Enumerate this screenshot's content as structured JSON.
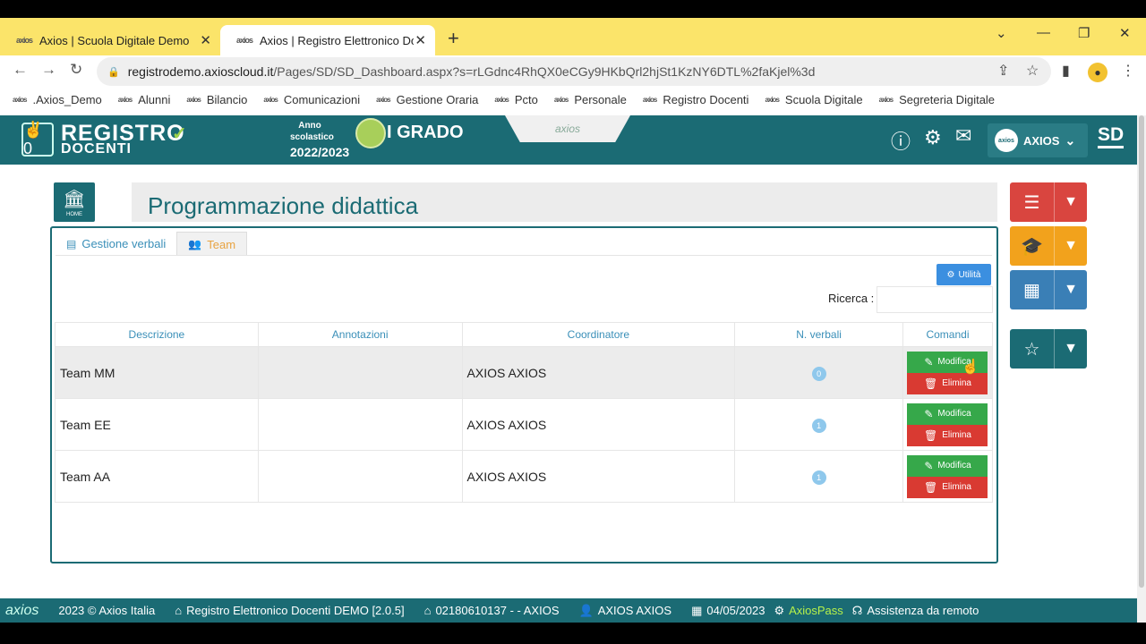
{
  "browser": {
    "tabs": [
      {
        "label": "Axios | Scuola Digitale Demo",
        "active": false
      },
      {
        "label": "Axios | Registro Elettronico Doce",
        "active": true
      }
    ],
    "favicon_text": "axios",
    "close_glyph": "✕",
    "new_tab_glyph": "+",
    "url_host": "registrodemo.axioscloud.it",
    "url_path": "/Pages/SD/SD_Dashboard.aspx?s=rLGdnc4RhQX0eCGy9HKbQrl2hjSt1KzNY6DTL%2faKjel%3d",
    "bookmarks": [
      ".Axios_Demo",
      "Alunni",
      "Bilancio",
      "Comunicazioni",
      "Gestione Oraria",
      "Pcto",
      "Personale",
      "Registro Docenti",
      "Scuola Digitale",
      "Segreteria Digitale"
    ]
  },
  "header": {
    "logo_line1": "REGISTRO",
    "logo_line2": "DOCENTI",
    "logo_badge": "✌0",
    "anno_label": "Anno scolastico",
    "anno_value": "2022/2023",
    "grado": "I GRADO",
    "center_logo": "axios",
    "user_avatar": "axios",
    "user_name": "AXIOS",
    "sd": "SD"
  },
  "page": {
    "home_label": "HOME",
    "title": "Programmazione didattica",
    "tabs": [
      {
        "label": "Gestione verbali",
        "active": false
      },
      {
        "label": "Team",
        "active": true
      }
    ],
    "utilita_label": "Utilità",
    "search_label": "Ricerca :",
    "search_value": ""
  },
  "table": {
    "columns": [
      "Descrizione",
      "Annotazioni",
      "Coordinatore",
      "N. verbali",
      "Comandi"
    ],
    "rows": [
      {
        "descrizione": "Team MM",
        "annotazioni": "",
        "coordinatore": "AXIOS AXIOS",
        "verbali": "0"
      },
      {
        "descrizione": "Team EE",
        "annotazioni": "",
        "coordinatore": "AXIOS AXIOS",
        "verbali": "1"
      },
      {
        "descrizione": "Team AA",
        "annotazioni": "",
        "coordinatore": "AXIOS AXIOS",
        "verbali": "1"
      }
    ],
    "modifica_label": "Modifica",
    "elimina_label": "Elimina"
  },
  "widgets": {
    "colors": [
      "#d9453f",
      "#f2a21c",
      "#3a7fb6",
      "#1b6b74"
    ],
    "icons": [
      "checklist-icon",
      "graduation-icon",
      "calculator-icon",
      "star-icon"
    ]
  },
  "footer": {
    "logo": "axios",
    "copyright": "2023 © Axios Italia",
    "product": "Registro Elettronico Docenti DEMO [2.0.5]",
    "school": "02180610137 - - AXIOS",
    "user": "AXIOS AXIOS",
    "date": "04/05/2023",
    "axiospass": "AxiosPass",
    "assistenza": "Assistenza da remoto"
  }
}
